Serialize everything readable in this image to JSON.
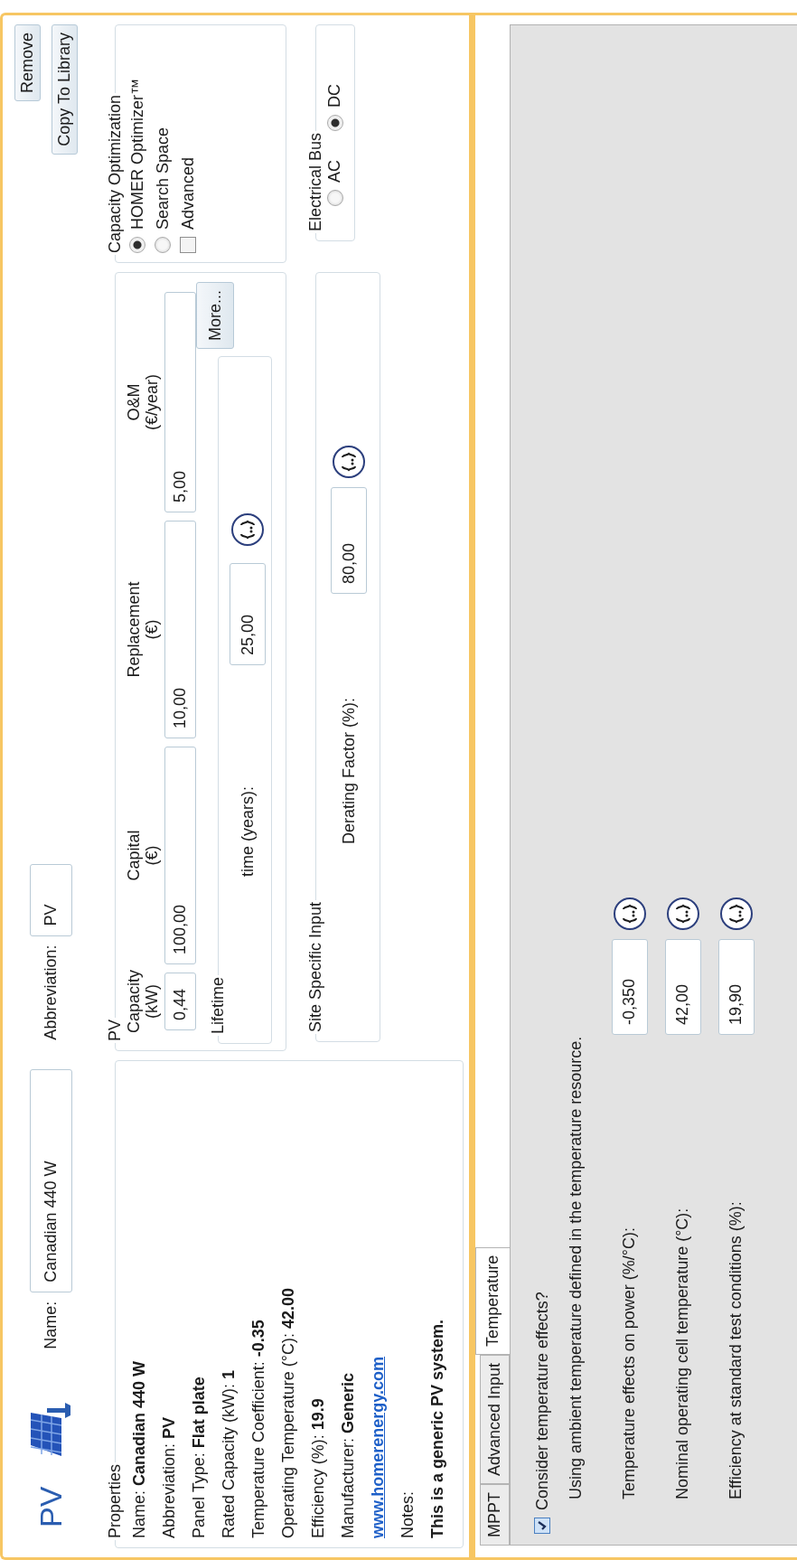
{
  "header": {
    "title": "PV",
    "name_label": "Name:",
    "name_value": "Canadian 440 W",
    "abbreviation_label": "Abbreviation:",
    "abbreviation_value": "PV",
    "buttons": [
      "Remove",
      "Copy To Library"
    ]
  },
  "properties": {
    "title": "Properties",
    "lines": [
      "Name: **Canadian 440 W**",
      "Abbreviation: **PV**",
      "Panel Type: **Flat plate**",
      "Rated Capacity (kW): **1**",
      "Temperature Coefficient: **-0.35**",
      "Operating Temperature (°C): **42.00**",
      "Efficiency (%): **19.9**",
      "Manufacturer: **Generic**"
    ],
    "link": "www.homerenergy.com",
    "notes_label": "Notes:",
    "notes": "This is a generic PV system."
  },
  "pv": {
    "title": "PV",
    "columns": [
      {
        "label": "Capacity",
        "unit": "(kW)",
        "value": "0,44"
      },
      {
        "label": "Capital",
        "unit": "(€)",
        "value": "100,00"
      },
      {
        "label": "Replacement",
        "unit": "(€)",
        "value": "10,00"
      },
      {
        "label": "O&M",
        "unit": "(€/year)",
        "value": "5,00"
      }
    ],
    "lifetime": {
      "title": "Lifetime",
      "label": "time (years):",
      "value": "25,00"
    },
    "more_button": "More..."
  },
  "capacity_optimization": {
    "title": "Capacity Optimization",
    "options": [
      {
        "label": "HOMER Optimizer™",
        "selected": true
      },
      {
        "label": "Search Space",
        "selected": false
      }
    ],
    "advanced": {
      "label": "Advanced",
      "checked": false
    }
  },
  "site_specific": {
    "title": "Site Specific Input",
    "label": "Derating Factor (%):",
    "value": "80,00"
  },
  "electrical_bus": {
    "title": "Electrical Bus",
    "options": [
      {
        "label": "AC",
        "selected": false
      },
      {
        "label": "DC",
        "selected": true
      }
    ]
  },
  "tabs": [
    {
      "label": "MPPT",
      "selected": false
    },
    {
      "label": "Advanced Input",
      "selected": false
    },
    {
      "label": "Temperature",
      "selected": true
    }
  ],
  "temperature": {
    "consider": {
      "label": "Consider temperature effects?",
      "checked": true
    },
    "note": "Using ambient temperature defined in the temperature resource.",
    "rows": [
      {
        "label": "Temperature effects on power (%/°C):",
        "value": "-0,350"
      },
      {
        "label": "Nominal operating cell temperature (°C):",
        "value": "42,00"
      },
      {
        "label": "Efficiency at standard test conditions (%):",
        "value": "19,90"
      }
    ]
  }
}
